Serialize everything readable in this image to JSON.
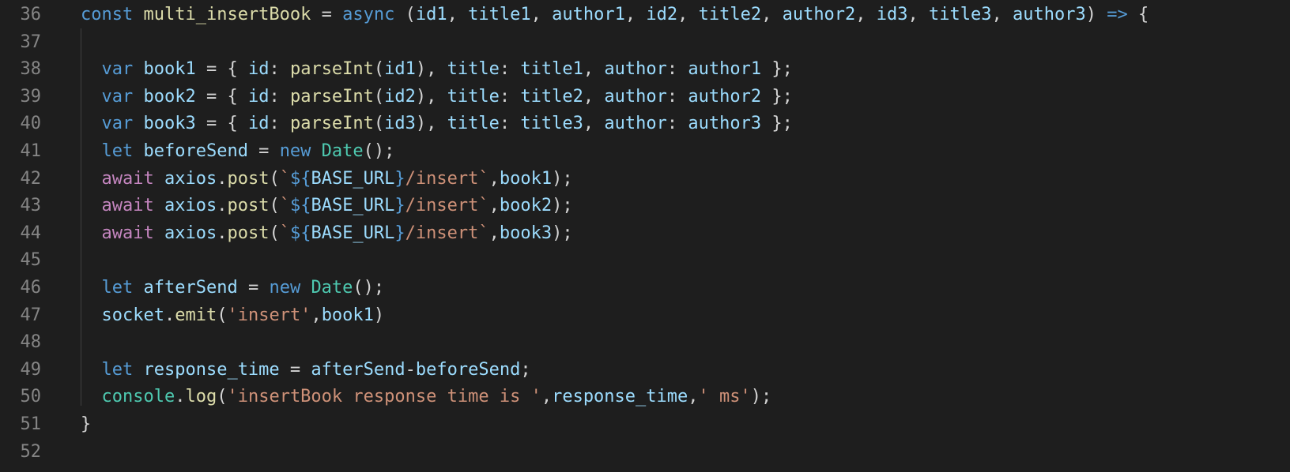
{
  "editor": {
    "lines": [
      {
        "number": "36",
        "tokens": [
          {
            "t": "const ",
            "c": "kw"
          },
          {
            "t": "multi_insertBook",
            "c": "fn"
          },
          {
            "t": " = ",
            "c": "pun"
          },
          {
            "t": "async",
            "c": "kw"
          },
          {
            "t": " (",
            "c": "pun"
          },
          {
            "t": "id1",
            "c": "var"
          },
          {
            "t": ", ",
            "c": "pun"
          },
          {
            "t": "title1",
            "c": "var"
          },
          {
            "t": ", ",
            "c": "pun"
          },
          {
            "t": "author1",
            "c": "var"
          },
          {
            "t": ", ",
            "c": "pun"
          },
          {
            "t": "id2",
            "c": "var"
          },
          {
            "t": ", ",
            "c": "pun"
          },
          {
            "t": "title2",
            "c": "var"
          },
          {
            "t": ", ",
            "c": "pun"
          },
          {
            "t": "author2",
            "c": "var"
          },
          {
            "t": ", ",
            "c": "pun"
          },
          {
            "t": "id3",
            "c": "var"
          },
          {
            "t": ", ",
            "c": "pun"
          },
          {
            "t": "title3",
            "c": "var"
          },
          {
            "t": ", ",
            "c": "pun"
          },
          {
            "t": "author3",
            "c": "var"
          },
          {
            "t": ") ",
            "c": "pun"
          },
          {
            "t": "=>",
            "c": "kw"
          },
          {
            "t": " {",
            "c": "pun"
          }
        ]
      },
      {
        "number": "37",
        "tokens": []
      },
      {
        "number": "38",
        "tokens": [
          {
            "t": "  ",
            "c": "pun"
          },
          {
            "t": "var ",
            "c": "kw"
          },
          {
            "t": "book1",
            "c": "var"
          },
          {
            "t": " = { ",
            "c": "pun"
          },
          {
            "t": "id",
            "c": "var"
          },
          {
            "t": ": ",
            "c": "pun"
          },
          {
            "t": "parseInt",
            "c": "fn"
          },
          {
            "t": "(",
            "c": "pun"
          },
          {
            "t": "id1",
            "c": "var"
          },
          {
            "t": "), ",
            "c": "pun"
          },
          {
            "t": "title",
            "c": "var"
          },
          {
            "t": ": ",
            "c": "pun"
          },
          {
            "t": "title1",
            "c": "var"
          },
          {
            "t": ", ",
            "c": "pun"
          },
          {
            "t": "author",
            "c": "var"
          },
          {
            "t": ": ",
            "c": "pun"
          },
          {
            "t": "author1",
            "c": "var"
          },
          {
            "t": " };",
            "c": "pun"
          }
        ]
      },
      {
        "number": "39",
        "tokens": [
          {
            "t": "  ",
            "c": "pun"
          },
          {
            "t": "var ",
            "c": "kw"
          },
          {
            "t": "book2",
            "c": "var"
          },
          {
            "t": " = { ",
            "c": "pun"
          },
          {
            "t": "id",
            "c": "var"
          },
          {
            "t": ": ",
            "c": "pun"
          },
          {
            "t": "parseInt",
            "c": "fn"
          },
          {
            "t": "(",
            "c": "pun"
          },
          {
            "t": "id2",
            "c": "var"
          },
          {
            "t": "), ",
            "c": "pun"
          },
          {
            "t": "title",
            "c": "var"
          },
          {
            "t": ": ",
            "c": "pun"
          },
          {
            "t": "title2",
            "c": "var"
          },
          {
            "t": ", ",
            "c": "pun"
          },
          {
            "t": "author",
            "c": "var"
          },
          {
            "t": ": ",
            "c": "pun"
          },
          {
            "t": "author2",
            "c": "var"
          },
          {
            "t": " };",
            "c": "pun"
          }
        ]
      },
      {
        "number": "40",
        "tokens": [
          {
            "t": "  ",
            "c": "pun"
          },
          {
            "t": "var ",
            "c": "kw"
          },
          {
            "t": "book3",
            "c": "var"
          },
          {
            "t": " = { ",
            "c": "pun"
          },
          {
            "t": "id",
            "c": "var"
          },
          {
            "t": ": ",
            "c": "pun"
          },
          {
            "t": "parseInt",
            "c": "fn"
          },
          {
            "t": "(",
            "c": "pun"
          },
          {
            "t": "id3",
            "c": "var"
          },
          {
            "t": "), ",
            "c": "pun"
          },
          {
            "t": "title",
            "c": "var"
          },
          {
            "t": ": ",
            "c": "pun"
          },
          {
            "t": "title3",
            "c": "var"
          },
          {
            "t": ", ",
            "c": "pun"
          },
          {
            "t": "author",
            "c": "var"
          },
          {
            "t": ": ",
            "c": "pun"
          },
          {
            "t": "author3",
            "c": "var"
          },
          {
            "t": " };",
            "c": "pun"
          }
        ]
      },
      {
        "number": "41",
        "tokens": [
          {
            "t": "  ",
            "c": "pun"
          },
          {
            "t": "let ",
            "c": "kw"
          },
          {
            "t": "beforeSend",
            "c": "var"
          },
          {
            "t": " = ",
            "c": "pun"
          },
          {
            "t": "new ",
            "c": "kw"
          },
          {
            "t": "Date",
            "c": "cls"
          },
          {
            "t": "();",
            "c": "pun"
          }
        ]
      },
      {
        "number": "42",
        "tokens": [
          {
            "t": "  ",
            "c": "pun"
          },
          {
            "t": "await ",
            "c": "ctl"
          },
          {
            "t": "axios",
            "c": "var"
          },
          {
            "t": ".",
            "c": "pun"
          },
          {
            "t": "post",
            "c": "fn"
          },
          {
            "t": "(",
            "c": "pun"
          },
          {
            "t": "`",
            "c": "str"
          },
          {
            "t": "${",
            "c": "kw"
          },
          {
            "t": "BASE_URL",
            "c": "var"
          },
          {
            "t": "}",
            "c": "kw"
          },
          {
            "t": "/insert`",
            "c": "str"
          },
          {
            "t": ",",
            "c": "pun"
          },
          {
            "t": "book1",
            "c": "var"
          },
          {
            "t": ");",
            "c": "pun"
          }
        ]
      },
      {
        "number": "43",
        "tokens": [
          {
            "t": "  ",
            "c": "pun"
          },
          {
            "t": "await ",
            "c": "ctl"
          },
          {
            "t": "axios",
            "c": "var"
          },
          {
            "t": ".",
            "c": "pun"
          },
          {
            "t": "post",
            "c": "fn"
          },
          {
            "t": "(",
            "c": "pun"
          },
          {
            "t": "`",
            "c": "str"
          },
          {
            "t": "${",
            "c": "kw"
          },
          {
            "t": "BASE_URL",
            "c": "var"
          },
          {
            "t": "}",
            "c": "kw"
          },
          {
            "t": "/insert`",
            "c": "str"
          },
          {
            "t": ",",
            "c": "pun"
          },
          {
            "t": "book2",
            "c": "var"
          },
          {
            "t": ");",
            "c": "pun"
          }
        ]
      },
      {
        "number": "44",
        "tokens": [
          {
            "t": "  ",
            "c": "pun"
          },
          {
            "t": "await ",
            "c": "ctl"
          },
          {
            "t": "axios",
            "c": "var"
          },
          {
            "t": ".",
            "c": "pun"
          },
          {
            "t": "post",
            "c": "fn"
          },
          {
            "t": "(",
            "c": "pun"
          },
          {
            "t": "`",
            "c": "str"
          },
          {
            "t": "${",
            "c": "kw"
          },
          {
            "t": "BASE_URL",
            "c": "var"
          },
          {
            "t": "}",
            "c": "kw"
          },
          {
            "t": "/insert`",
            "c": "str"
          },
          {
            "t": ",",
            "c": "pun"
          },
          {
            "t": "book3",
            "c": "var"
          },
          {
            "t": ");",
            "c": "pun"
          }
        ]
      },
      {
        "number": "45",
        "tokens": []
      },
      {
        "number": "46",
        "tokens": [
          {
            "t": "  ",
            "c": "pun"
          },
          {
            "t": "let ",
            "c": "kw"
          },
          {
            "t": "afterSend",
            "c": "var"
          },
          {
            "t": " = ",
            "c": "pun"
          },
          {
            "t": "new ",
            "c": "kw"
          },
          {
            "t": "Date",
            "c": "cls"
          },
          {
            "t": "();",
            "c": "pun"
          }
        ]
      },
      {
        "number": "47",
        "tokens": [
          {
            "t": "  ",
            "c": "pun"
          },
          {
            "t": "socket",
            "c": "var"
          },
          {
            "t": ".",
            "c": "pun"
          },
          {
            "t": "emit",
            "c": "fn"
          },
          {
            "t": "(",
            "c": "pun"
          },
          {
            "t": "'insert'",
            "c": "str"
          },
          {
            "t": ",",
            "c": "pun"
          },
          {
            "t": "book1",
            "c": "var"
          },
          {
            "t": ")",
            "c": "pun"
          }
        ]
      },
      {
        "number": "48",
        "tokens": []
      },
      {
        "number": "49",
        "tokens": [
          {
            "t": "  ",
            "c": "pun"
          },
          {
            "t": "let ",
            "c": "kw"
          },
          {
            "t": "response_time",
            "c": "var"
          },
          {
            "t": " = ",
            "c": "pun"
          },
          {
            "t": "afterSend",
            "c": "var"
          },
          {
            "t": "-",
            "c": "pun"
          },
          {
            "t": "beforeSend",
            "c": "var"
          },
          {
            "t": ";",
            "c": "pun"
          }
        ]
      },
      {
        "number": "50",
        "tokens": [
          {
            "t": "  ",
            "c": "pun"
          },
          {
            "t": "console",
            "c": "cls"
          },
          {
            "t": ".",
            "c": "pun"
          },
          {
            "t": "log",
            "c": "fn"
          },
          {
            "t": "(",
            "c": "pun"
          },
          {
            "t": "'insertBook response time is '",
            "c": "str"
          },
          {
            "t": ",",
            "c": "pun"
          },
          {
            "t": "response_time",
            "c": "var"
          },
          {
            "t": ",",
            "c": "pun"
          },
          {
            "t": "' ms'",
            "c": "str"
          },
          {
            "t": ");",
            "c": "pun"
          }
        ]
      },
      {
        "number": "51",
        "tokens": [
          {
            "t": "}",
            "c": "pun"
          }
        ]
      },
      {
        "number": "52",
        "tokens": []
      }
    ]
  }
}
